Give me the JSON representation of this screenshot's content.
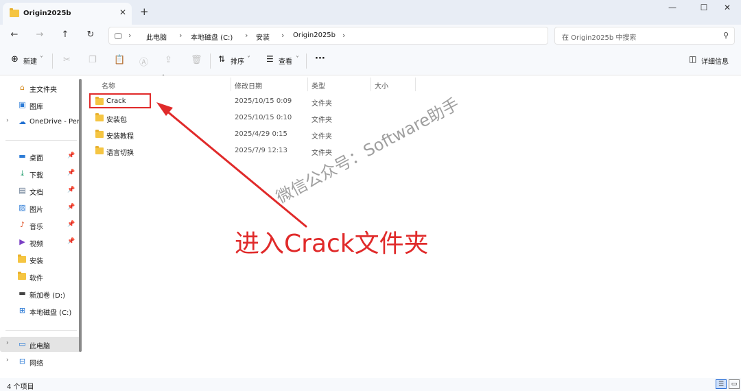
{
  "tab": {
    "title": "Origin2025b",
    "close": "✕",
    "new_tab": "+"
  },
  "window": {
    "minimize": "—",
    "maximize": "☐",
    "close": "✕"
  },
  "nav": {
    "back": "←",
    "forward": "→",
    "up": "↑",
    "refresh": "↻",
    "breadcrumbs": [
      "此电脑",
      "本地磁盘 (C:)",
      "安装",
      "Origin2025b"
    ],
    "sep": "›",
    "search_placeholder": "在 Origin2025b 中搜索"
  },
  "toolbar": {
    "new_label": "新建",
    "sort_label": "排序",
    "view_label": "查看",
    "more_label": "···",
    "details_label": "详细信息"
  },
  "sidebar": {
    "items": [
      {
        "label": "主文件夹",
        "icon": "home-icon"
      },
      {
        "label": "图库",
        "icon": "gallery-icon"
      },
      {
        "label": "OneDrive - Per",
        "icon": "cloud-icon"
      },
      {
        "label": "桌面",
        "icon": "desktop-icon"
      },
      {
        "label": "下载",
        "icon": "download-icon"
      },
      {
        "label": "文档",
        "icon": "document-icon"
      },
      {
        "label": "图片",
        "icon": "picture-icon"
      },
      {
        "label": "音乐",
        "icon": "music-icon"
      },
      {
        "label": "视频",
        "icon": "video-icon"
      },
      {
        "label": "安装",
        "icon": "folder-icon"
      },
      {
        "label": "软件",
        "icon": "folder-icon"
      },
      {
        "label": "新加卷 (D:)",
        "icon": "drive-icon"
      },
      {
        "label": "本地磁盘 (C:)",
        "icon": "windows-drive-icon"
      },
      {
        "label": "此电脑",
        "icon": "computer-icon"
      },
      {
        "label": "网络",
        "icon": "network-icon"
      }
    ]
  },
  "columns": {
    "name": "名称",
    "modified": "修改日期",
    "type": "类型",
    "size": "大小"
  },
  "files": [
    {
      "name": "Crack",
      "modified": "2025/10/15 0:09",
      "type": "文件夹"
    },
    {
      "name": "安装包",
      "modified": "2025/10/15 0:10",
      "type": "文件夹"
    },
    {
      "name": "安装教程",
      "modified": "2025/4/29 0:15",
      "type": "文件夹"
    },
    {
      "name": "语言切换",
      "modified": "2025/7/9 12:13",
      "type": "文件夹"
    }
  ],
  "status": {
    "item_count": "4 个项目"
  },
  "annotation": {
    "text": "进入Crack文件夹",
    "color": "#e02a2a"
  },
  "watermark": {
    "text": "微信公众号：Software助手"
  }
}
